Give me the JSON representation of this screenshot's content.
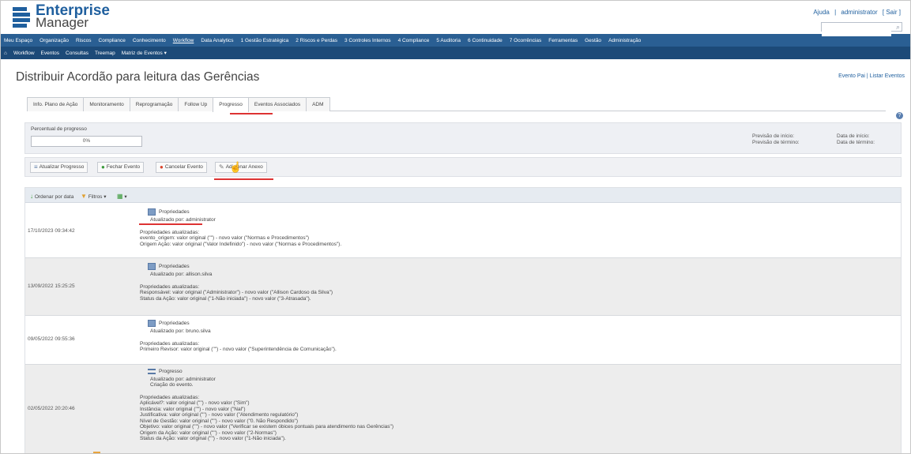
{
  "header": {
    "logo_line1": "Enterprise",
    "logo_line2": "Manager",
    "top_links": [
      "Ajuda",
      "|",
      "administrator",
      "[ Sair ]"
    ],
    "search_placeholder": ""
  },
  "nav_main": [
    "Meu Espaço",
    "Organização",
    "Riscos",
    "Compliance",
    "Conhecimento",
    "Workflow",
    "Data Analytics",
    "1 Gestão Estratégica",
    "2 Riscos e Perdas",
    "3 Controles Internos",
    "4 Compliance",
    "5 Auditoria",
    "6 Continuidade",
    "7 Ocorrências",
    "Ferramentas",
    "Gestão",
    "Administração"
  ],
  "nav_active_index": 5,
  "nav_sub": [
    "Workflow",
    "Eventos",
    "Consultas",
    "Treemap",
    "Matriz de Eventos ▾"
  ],
  "page": {
    "title": "Distribuir Acordão para leitura das Gerências",
    "title_links": "Evento Pai | Listar Eventos"
  },
  "tabs": [
    "Info. Plano de Ação",
    "Monitoramento",
    "Reprogramação",
    "Follow Up",
    "Progresso",
    "Eventos Associados",
    "ADM"
  ],
  "active_tab_index": 4,
  "progress": {
    "label": "Percentual de progresso",
    "value": "0%",
    "previsao_inicio": "Previsão de início:",
    "previsao_termino": "Previsão de término:",
    "data_inicio": "Data de início:",
    "data_termino": "Data de término:"
  },
  "actions": {
    "atualizar": "Atualizar Progresso",
    "fechar": "Fechar Evento",
    "cancelar": "Cancelar Evento",
    "adicionar": "Adicionar Anexo"
  },
  "list_toolbar": {
    "ordenar": "Ordenar por data",
    "filtros": "Filtros ▾",
    "calendar": "▾"
  },
  "rows": [
    {
      "date": "17/10/2023 09:34:42",
      "header": "Propriedades",
      "by": "Atualizado por: administrator",
      "sub_title": "Propriedades atualizadas:",
      "lines": [
        "evento_origem: valor original (\"\") - novo valor (\"Normas e Procedimentos\")",
        "Origem Ação: valor original (\"Valor Indefinido\") - novo valor (\"Normas e Procedimentos\")."
      ]
    },
    {
      "date": "13/09/2022 15:25:25",
      "header": "Propriedades",
      "by": "Atualizado por: allison.silva",
      "sub_title": "Propriedades atualizadas:",
      "lines": [
        "Responsável: valor original (\"Administrator\") - novo valor (\"Allison Cardoso da Silva\")",
        "Status da Ação: valor original (\"1-Não iniciada\") - novo valor (\"3-Atrasada\")."
      ]
    },
    {
      "date": "09/05/2022 09:55:36",
      "header": "Propriedades",
      "by": "Atualizado por: bruno.silva",
      "sub_title": "Propriedades atualizadas:",
      "lines": [
        "Primeiro Revisor: valor original (\"\") - novo valor (\"Superintendência de Comunicação\")."
      ]
    },
    {
      "date": "02/05/2022 20:20:46",
      "header": "Progresso",
      "by": "Atualizado por: administrator",
      "extra": "Criação do evento.",
      "sub_title": "Propriedades atualizadas:",
      "lines": [
        "Aplicável?: valor original (\"\") - novo valor (\"Sim\")",
        "Instância: valor original (\"\") - novo valor (\"Nal\")",
        "Justificativa: valor original (\"\") - novo valor (\"Atendimento regulatório\")",
        "Nível de Gestão: valor original (\"\") - novo valor (\"0. Não Respondido\")",
        "Objetivo: valor original (\"\") - novo valor (\"Verificar se existem óbices pontuais para atendimento nas Gerências\")",
        "Origem da Ação: valor original (\"\") - novo valor (\"2-Normas\")",
        "Status da Ação: valor original (\"\") - novo valor (\"1-Não iniciada\")."
      ]
    }
  ]
}
